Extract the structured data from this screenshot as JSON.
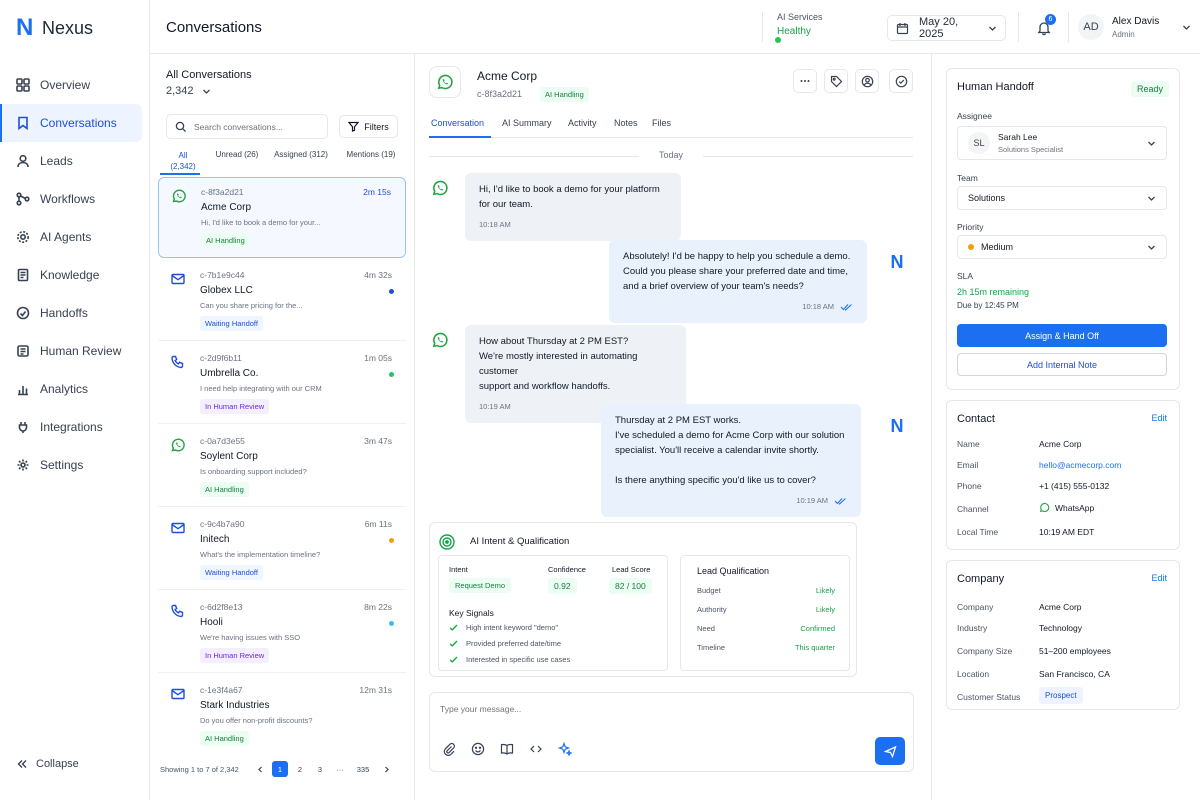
{
  "app": {
    "name": "Nexus",
    "logo_mark": "N"
  },
  "sidebar": {
    "items": [
      {
        "label": "Overview",
        "icon": "grid-icon"
      },
      {
        "label": "Conversations",
        "icon": "bookmark-icon",
        "active": true
      },
      {
        "label": "Leads",
        "icon": "user-icon"
      },
      {
        "label": "Workflows",
        "icon": "workflow-icon"
      },
      {
        "label": "AI Agents",
        "icon": "gear-icon"
      },
      {
        "label": "Knowledge",
        "icon": "document-icon"
      },
      {
        "label": "Handoffs",
        "icon": "handoff-icon"
      },
      {
        "label": "Human Review",
        "icon": "review-icon"
      },
      {
        "label": "Analytics",
        "icon": "bar-chart-icon"
      },
      {
        "label": "Integrations",
        "icon": "plug-icon"
      },
      {
        "label": "Settings",
        "icon": "settings-icon"
      }
    ],
    "collapse_label": "Collapse"
  },
  "header": {
    "title": "Conversations",
    "ai_services_label": "AI Services",
    "ai_services_status": "Healthy",
    "date": "May 20, 2025",
    "notification_count": "6",
    "user": {
      "initials": "AD",
      "name": "Alex Davis",
      "role": "Admin"
    }
  },
  "list": {
    "title": "All Conversations",
    "count": "2,342",
    "search_placeholder": "Search conversations...",
    "filters_label": "Filters",
    "tabs": [
      {
        "label": "All",
        "count": "(2,342)"
      },
      {
        "label": "Unread (26)"
      },
      {
        "label": "Assigned (312)"
      },
      {
        "label": "Mentions (19)"
      }
    ],
    "items": [
      {
        "id": "c-8f3a2d21",
        "time": "2m 15s",
        "name": "Acme Corp",
        "preview": "Hi, I'd like to book a demo for your...",
        "tag": "AI Handling",
        "channel": "whatsapp"
      },
      {
        "id": "c-7b1e9c44",
        "time": "4m 32s",
        "name": "Globex LLC",
        "preview": "Can you share pricing for the...",
        "tag": "Waiting Handoff",
        "channel": "email"
      },
      {
        "id": "c-2d9f6b11",
        "time": "1m 05s",
        "name": "Umbrella Co.",
        "preview": "I need help integrating with our CRM",
        "tag": "In Human Review",
        "channel": "phone"
      },
      {
        "id": "c-0a7d3e55",
        "time": "3m 47s",
        "name": "Soylent Corp",
        "preview": "Is onboarding support included?",
        "tag": "AI Handling",
        "channel": "whatsapp"
      },
      {
        "id": "c-9c4b7a90",
        "time": "6m 11s",
        "name": "Initech",
        "preview": "What's the implementation timeline?",
        "tag": "Waiting Handoff",
        "channel": "email"
      },
      {
        "id": "c-6d2f8e13",
        "time": "8m 22s",
        "name": "Hooli",
        "preview": "We're having issues with SSO",
        "tag": "In Human Review",
        "channel": "phone"
      },
      {
        "id": "c-1e3f4a67",
        "time": "12m 31s",
        "name": "Stark Industries",
        "preview": "Do you offer non-profit discounts?",
        "tag": "AI Handling",
        "channel": "email"
      }
    ],
    "pagination": {
      "summary": "Showing 1 to 7 of 2,342",
      "pages": [
        "1",
        "2",
        "3",
        "335"
      ],
      "ellipsis": "···"
    }
  },
  "chat": {
    "name": "Acme Corp",
    "id": "c-8f3a2d21",
    "tag": "AI Handling",
    "tabs": [
      "Conversation",
      "AI Summary",
      "Activity",
      "Notes",
      "Files"
    ],
    "day_separator": "Today",
    "messages": [
      {
        "dir": "in",
        "lines": [
          "Hi, I'd like to book a demo for your platform",
          "for our team."
        ],
        "time": "10:18 AM"
      },
      {
        "dir": "out",
        "lines": [
          "Absolutely! I'd be happy to help you schedule a demo.",
          "Could you please share your preferred date and time,",
          "and a brief overview of your team's needs?"
        ],
        "time": "10:18 AM"
      },
      {
        "dir": "in",
        "lines": [
          "How about Thursday at 2 PM EST?",
          "We're mostly interested in automating customer",
          "support and workflow handoffs."
        ],
        "time": "10:19 AM"
      },
      {
        "dir": "out",
        "lines": [
          "Thursday at 2 PM EST works.",
          "I've scheduled a demo for Acme Corp with our solution",
          "specialist. You'll receive a calendar invite shortly.",
          "",
          "Is there anything specific you'd like us to cover?"
        ],
        "time": "10:19 AM"
      }
    ],
    "ai_card": {
      "title": "AI Intent & Qualification",
      "intent_label": "Intent",
      "intent_value": "Request Demo",
      "confidence_label": "Confidence",
      "confidence_value": "0.92",
      "lead_score_label": "Lead Score",
      "lead_score_value": "82 / 100",
      "key_signals_title": "Key Signals",
      "key_signals": [
        "High intent keyword \"demo\"",
        "Provided preferred date/time",
        "Interested in specific use cases"
      ],
      "lead_qual_title": "Lead Qualification",
      "lead_qual": [
        {
          "k": "Budget",
          "v": "Likely"
        },
        {
          "k": "Authority",
          "v": "Likely"
        },
        {
          "k": "Need",
          "v": "Confirmed"
        },
        {
          "k": "Timeline",
          "v": "This quarter"
        }
      ]
    },
    "composer_placeholder": "Type your message..."
  },
  "handoff": {
    "title": "Human Handoff",
    "status": "Ready",
    "assignee_label": "Assignee",
    "assignee": {
      "initials": "SL",
      "name": "Sarah Lee",
      "role": "Solutions Specialist"
    },
    "team_label": "Team",
    "team": "Solutions",
    "priority_label": "Priority",
    "priority": "Medium",
    "sla_label": "SLA",
    "sla_remaining": "2h 15m remaining",
    "sla_due": "Due by 12:45 PM",
    "assign_button": "Assign & Hand Off",
    "note_button": "Add Internal Note"
  },
  "contact": {
    "title": "Contact",
    "edit": "Edit",
    "fields": [
      {
        "k": "Name",
        "v": "Acme Corp"
      },
      {
        "k": "Email",
        "v": "hello@acmecorp.com"
      },
      {
        "k": "Phone",
        "v": "+1 (415) 555-0132"
      },
      {
        "k": "Channel",
        "v": "WhatsApp"
      },
      {
        "k": "Local Time",
        "v": "10:19 AM EDT"
      }
    ]
  },
  "company": {
    "title": "Company",
    "edit": "Edit",
    "fields": [
      {
        "k": "Company",
        "v": "Acme Corp"
      },
      {
        "k": "Industry",
        "v": "Technology"
      },
      {
        "k": "Company Size",
        "v": "51–200 employees"
      },
      {
        "k": "Location",
        "v": "San Francisco, CA"
      },
      {
        "k": "Customer Status",
        "v": "Prospect"
      }
    ]
  },
  "colors": {
    "accent": "#1d6ff2",
    "success": "#16a34a",
    "whatsapp": "#25a244",
    "warn": "#f59e0b"
  }
}
